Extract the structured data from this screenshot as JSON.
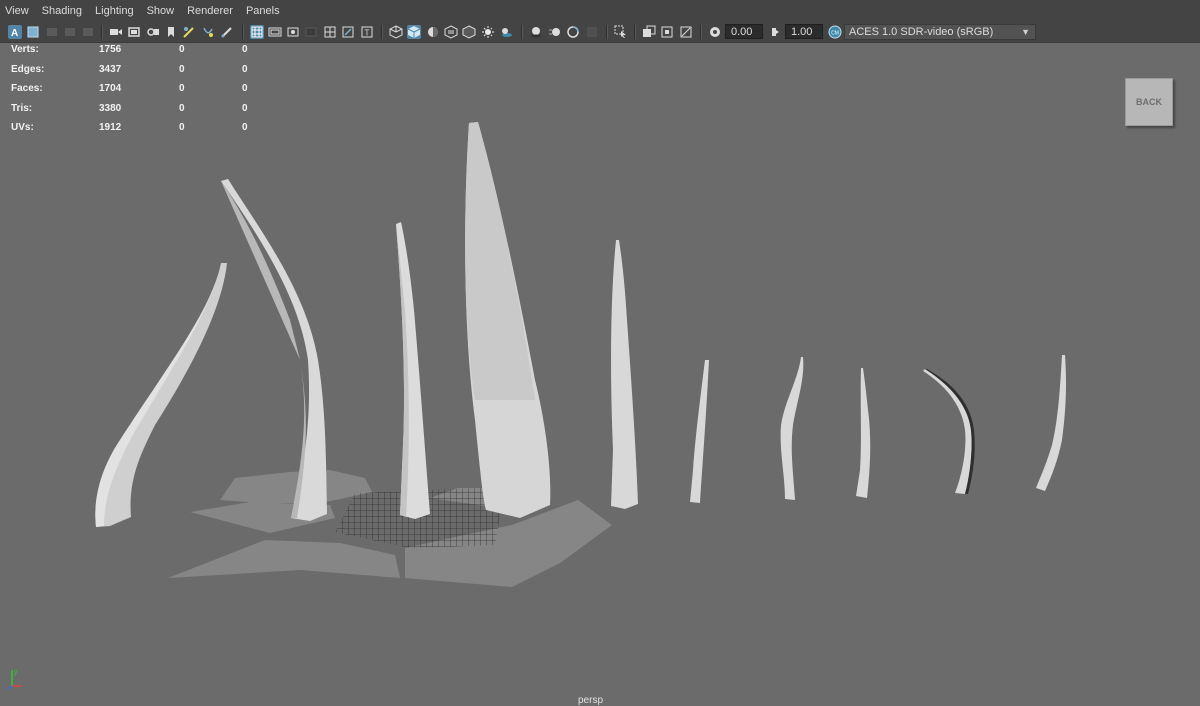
{
  "menu": [
    "View",
    "Shading",
    "Lighting",
    "Show",
    "Renderer",
    "Panels"
  ],
  "toolbar": {
    "exposure": "0.00",
    "gamma": "1.00",
    "color_space": "ACES 1.0 SDR-video (sRGB)"
  },
  "hud": {
    "rows": [
      {
        "label": "Verts:",
        "a": "1756",
        "b": "0",
        "c": "0"
      },
      {
        "label": "Edges:",
        "a": "3437",
        "b": "0",
        "c": "0"
      },
      {
        "label": "Faces:",
        "a": "1704",
        "b": "0",
        "c": "0"
      },
      {
        "label": "Tris:",
        "a": "3380",
        "b": "0",
        "c": "0"
      },
      {
        "label": "UVs:",
        "a": "1912",
        "b": "0",
        "c": "0"
      }
    ]
  },
  "viewcube": {
    "label": "BACK"
  },
  "camera": {
    "label": "persp"
  },
  "colors": {
    "background": "#6b6b6b",
    "toolbar": "#444444",
    "highlight": "#5285a6",
    "object": "#cfcfcf"
  }
}
